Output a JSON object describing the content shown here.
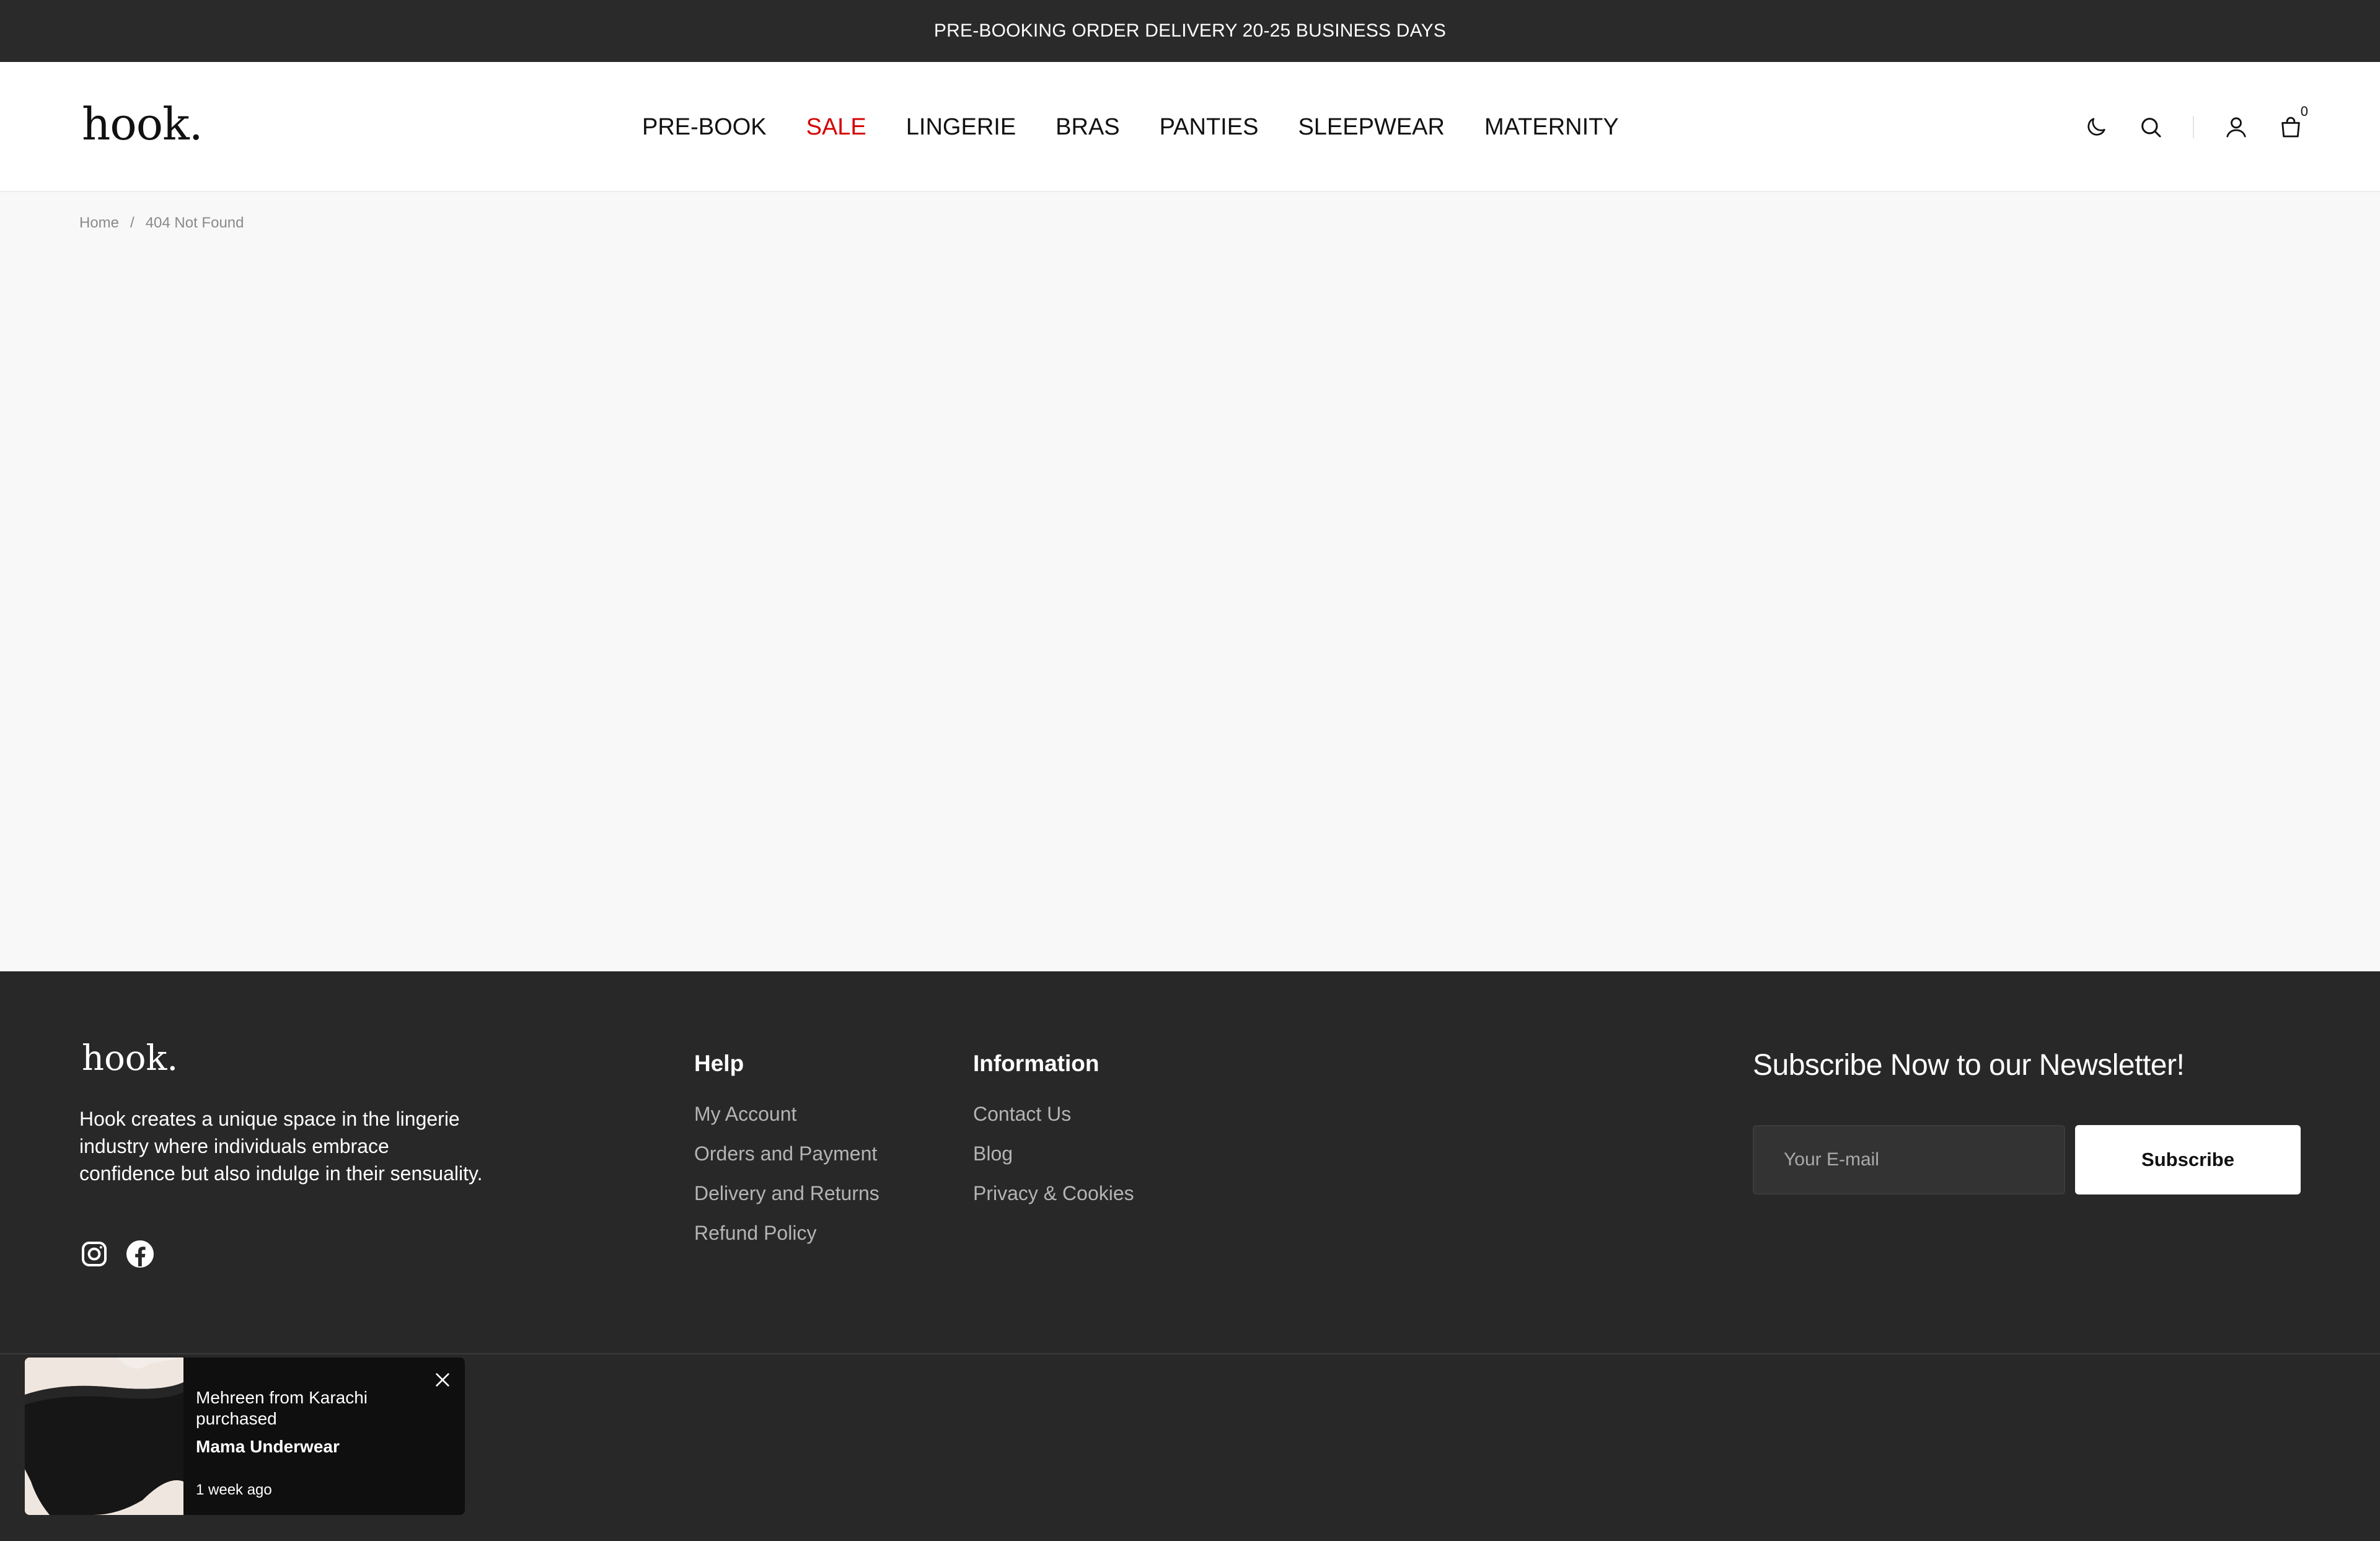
{
  "announcement": {
    "text": "PRE-BOOKING ORDER DELIVERY 20-25 BUSINESS DAYS"
  },
  "header": {
    "logo": "hook.",
    "nav": [
      {
        "label": "PRE-BOOK"
      },
      {
        "label": "SALE",
        "color": "#d40000"
      },
      {
        "label": "LINGERIE"
      },
      {
        "label": "BRAS"
      },
      {
        "label": "PANTIES"
      },
      {
        "label": "SLEEPWEAR"
      },
      {
        "label": "MATERNITY"
      }
    ],
    "icons": [
      "moon-icon",
      "search-icon",
      "user-icon",
      "bag-icon"
    ],
    "cart_count": "0"
  },
  "breadcrumb": {
    "home": "Home",
    "separator": "/",
    "current": "404 Not Found"
  },
  "footer": {
    "logo": "hook.",
    "description": "Hook creates a unique space in the lingerie industry where individuals embrace confidence but also indulge in their sensuality.",
    "social": [
      "instagram-icon",
      "facebook-icon"
    ],
    "help": {
      "title": "Help",
      "links": [
        "My Account",
        "Orders and Payment",
        "Delivery and Returns",
        "Refund Policy"
      ]
    },
    "information": {
      "title": "Information",
      "links": [
        "Contact Us",
        "Blog",
        "Privacy & Cookies"
      ]
    },
    "newsletter": {
      "title": "Subscribe Now to our Newsletter!",
      "placeholder": "Your E-mail",
      "button": "Subscribe"
    }
  },
  "toast": {
    "line": "Mehreen from Karachi purchased",
    "product": "Mama Underwear",
    "time": "1 week ago"
  }
}
